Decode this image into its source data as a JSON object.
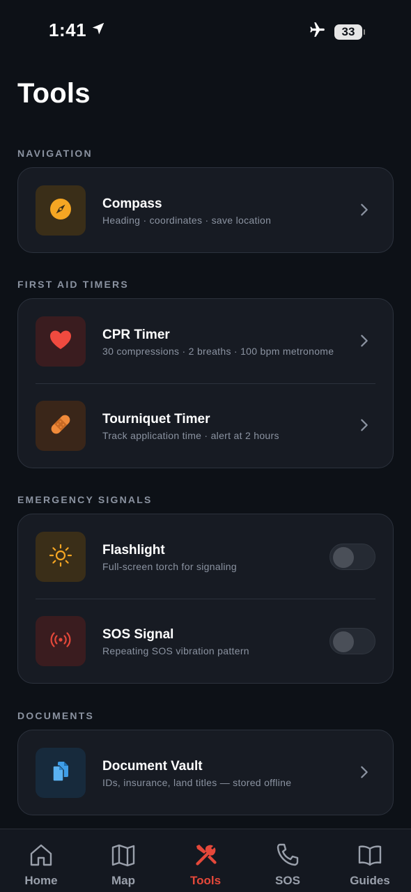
{
  "status_bar": {
    "time": "1:41",
    "battery": "33"
  },
  "page": {
    "title": "Tools"
  },
  "sections": {
    "navigation": {
      "label": "NAVIGATION",
      "items": [
        {
          "title": "Compass",
          "subtitle": "Heading · coordinates · save location",
          "icon": "compass-icon"
        }
      ]
    },
    "first_aid": {
      "label": "FIRST AID TIMERS",
      "items": [
        {
          "title": "CPR Timer",
          "subtitle": "30 compressions · 2 breaths · 100 bpm metronome",
          "icon": "heart-icon"
        },
        {
          "title": "Tourniquet Timer",
          "subtitle": "Track application time · alert at 2 hours",
          "icon": "bandage-icon"
        }
      ]
    },
    "emergency": {
      "label": "EMERGENCY SIGNALS",
      "items": [
        {
          "title": "Flashlight",
          "subtitle": "Full-screen torch for signaling",
          "icon": "sun-icon",
          "enabled": false
        },
        {
          "title": "SOS Signal",
          "subtitle": "Repeating SOS vibration pattern",
          "icon": "broadcast-icon",
          "enabled": false
        }
      ]
    },
    "documents": {
      "label": "DOCUMENTS",
      "items": [
        {
          "title": "Document Vault",
          "subtitle": "IDs, insurance, land titles — stored offline",
          "icon": "documents-icon"
        }
      ]
    }
  },
  "tab_bar": {
    "active": "Tools",
    "tabs": [
      {
        "label": "Home",
        "icon": "home-icon"
      },
      {
        "label": "Map",
        "icon": "map-icon"
      },
      {
        "label": "Tools",
        "icon": "tools-icon"
      },
      {
        "label": "SOS",
        "icon": "phone-icon"
      },
      {
        "label": "Guides",
        "icon": "book-icon"
      }
    ]
  },
  "colors": {
    "background": "#0d1117",
    "card": "#171b23",
    "accent_active": "#e5483a",
    "compass": "#f5a623",
    "heart": "#ef4a3f",
    "bandage": "#f08a3a",
    "sun": "#f5a623",
    "sos": "#e5483a",
    "documents": "#3f9ee8"
  }
}
